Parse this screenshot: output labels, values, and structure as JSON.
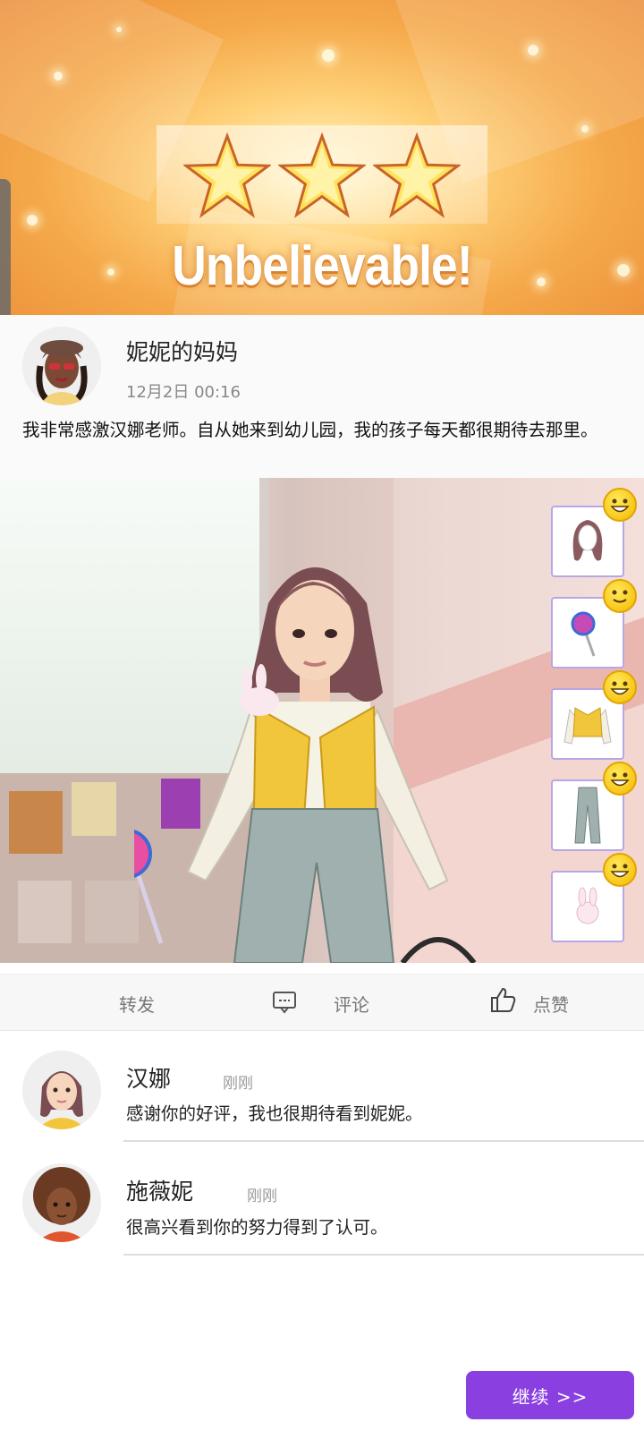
{
  "banner": {
    "title": "Unbelievable!",
    "stars": 3
  },
  "post": {
    "author": "妮妮的妈妈",
    "time": "12月2日 00:16",
    "text": "我非常感激汉娜老师。自从她来到幼儿园，我的孩子每天都很期待去那里。"
  },
  "outfit_items": [
    {
      "name": "hair",
      "rating": "grin"
    },
    {
      "name": "lollipop",
      "rating": "smile"
    },
    {
      "name": "vest-top",
      "rating": "grin"
    },
    {
      "name": "jeans",
      "rating": "grin"
    },
    {
      "name": "bunny-pet",
      "rating": "grin"
    }
  ],
  "actions": {
    "share": "转发",
    "comment": "评论",
    "like": "点赞"
  },
  "comments": [
    {
      "name": "汉娜",
      "time": "刚刚",
      "text": "感谢你的好评，我也很期待看到妮妮。"
    },
    {
      "name": "施薇妮",
      "time": "刚刚",
      "text": "很高兴看到你的努力得到了认可。"
    }
  ],
  "continue_label": "继续 >>",
  "colors": {
    "accent": "#8a3fe0",
    "banner": "#f5a94a",
    "slot_border": "#b9a6e8"
  }
}
